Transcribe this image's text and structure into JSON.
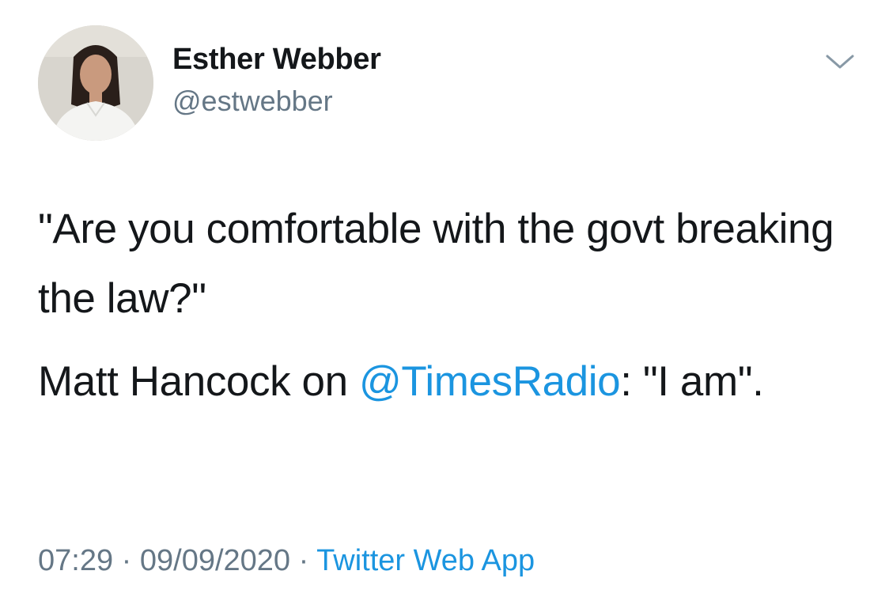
{
  "author": {
    "display_name": "Esther Webber",
    "handle": "@estwebber"
  },
  "tweet": {
    "paragraph1": "\"Are you comfortable with the govt breaking the law?\"",
    "paragraph2_prefix": "Matt Hancock on ",
    "mention": "@TimesRadio",
    "paragraph2_suffix": ": \"I am\"."
  },
  "meta": {
    "time": "07:29",
    "separator": " · ",
    "date": "09/09/2020",
    "source": "Twitter Web App"
  },
  "colors": {
    "link": "#1b95e0",
    "secondary_text": "#657786",
    "primary_text": "#14171a"
  },
  "icons": {
    "menu": "chevron-down-icon"
  }
}
